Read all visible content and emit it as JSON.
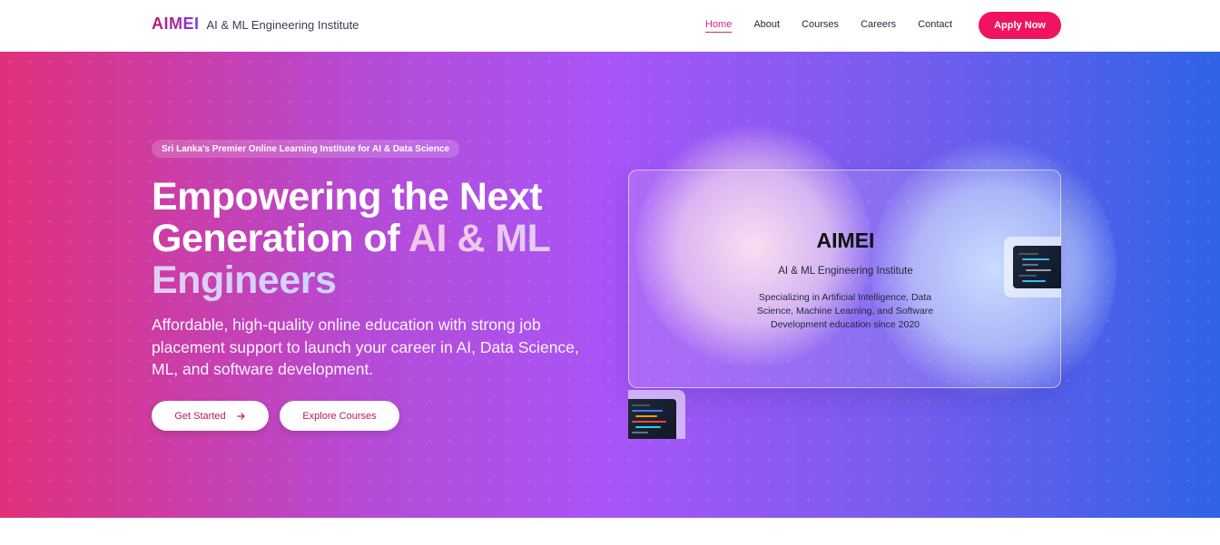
{
  "navbar": {
    "logo": "AIMEI",
    "brand_sub": "AI & ML Engineering Institute",
    "links": [
      "Home",
      "About",
      "Courses",
      "Careers",
      "Contact"
    ],
    "active_link": "Home",
    "apply_label": "Apply Now"
  },
  "hero": {
    "badge": "Sri Lanka's Premier Online Learning Institute for AI & Data Science",
    "headline_part1": "Empowering the Next Generation of",
    "headline_accent": "AI & ML Engineers",
    "subtext": "Affordable, high-quality online education with strong job placement support to launch your career in AI, Data Science, ML, and software development.",
    "get_started_label": "Get Started",
    "get_started_icon": "arrow-right-icon",
    "explore_label": "Explore Courses"
  },
  "card": {
    "title": "AIMEI",
    "subtitle": "AI & ML Engineering Institute",
    "description": "Specializing in Artificial Intelligence, Data Science, Machine Learning, and Software Development education since 2020"
  },
  "colors": {
    "accent": "#f0135f",
    "link_active": "#db2777",
    "hero_start": "#e0307a",
    "hero_mid": "#a855f7",
    "hero_end": "#2f63e6"
  }
}
